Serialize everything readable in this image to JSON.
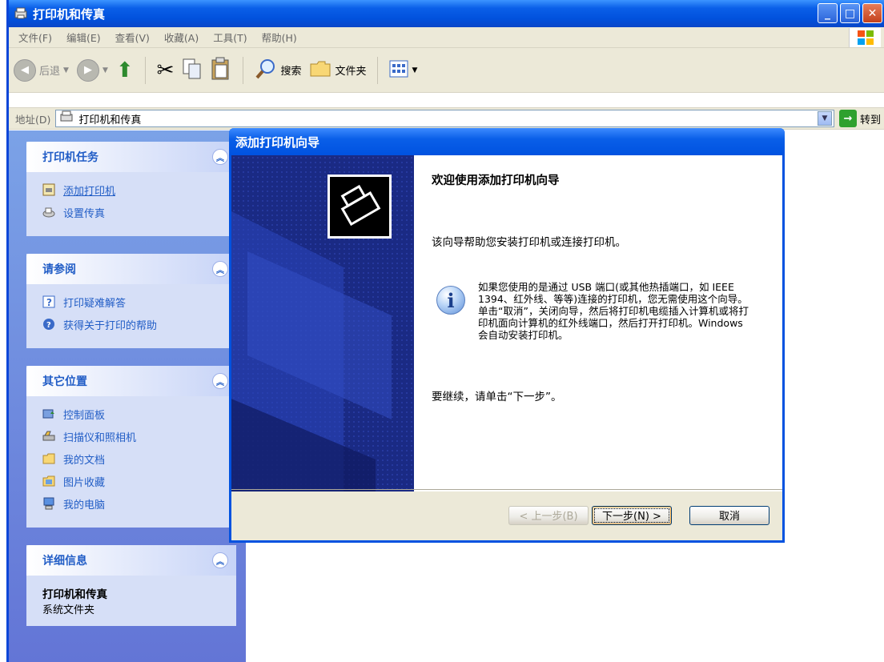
{
  "window": {
    "title": "打印机和传真",
    "controls": [
      "minimize",
      "maximize",
      "close"
    ]
  },
  "menubar": {
    "items": [
      "文件(F)",
      "编辑(E)",
      "查看(V)",
      "收藏(A)",
      "工具(T)",
      "帮助(H)"
    ]
  },
  "toolbar": {
    "back_label": "后退",
    "search_label": "搜索",
    "folders_label": "文件夹"
  },
  "address": {
    "label": "地址(D)",
    "value": "打印机和传真",
    "go_label": "转到"
  },
  "left_pane": {
    "printer_tasks": {
      "title": "打印机任务",
      "items": [
        "添加打印机",
        "设置传真"
      ]
    },
    "see_also": {
      "title": "请参阅",
      "items": [
        "打印疑难解答",
        "获得关于打印的帮助"
      ]
    },
    "other_places": {
      "title": "其它位置",
      "items": [
        "控制面板",
        "扫描仪和照相机",
        "我的文档",
        "图片收藏",
        "我的电脑"
      ]
    },
    "details": {
      "title": "详细信息",
      "name": "打印机和传真",
      "type": "系统文件夹"
    }
  },
  "dialog": {
    "title": "添加打印机向导",
    "welcome": "欢迎使用添加打印机向导",
    "intro": "该向导帮助您安装打印机或连接打印机。",
    "info": "如果您使用的是通过 USB 端口(或其他热插端口，如 IEEE 1394、红外线、等等)连接的打印机，您无需使用这个向导。单击“取消”，关闭向导，然后将打印机电缆插入计算机或将打印机面向计算机的红外线端口，然后打开打印机。Windows 会自动安装打印机。",
    "continue": "要继续，请单击“下一步”。",
    "buttons": {
      "back": "< 上一步(B)",
      "next": "下一步(N) >",
      "cancel": "取消"
    }
  }
}
